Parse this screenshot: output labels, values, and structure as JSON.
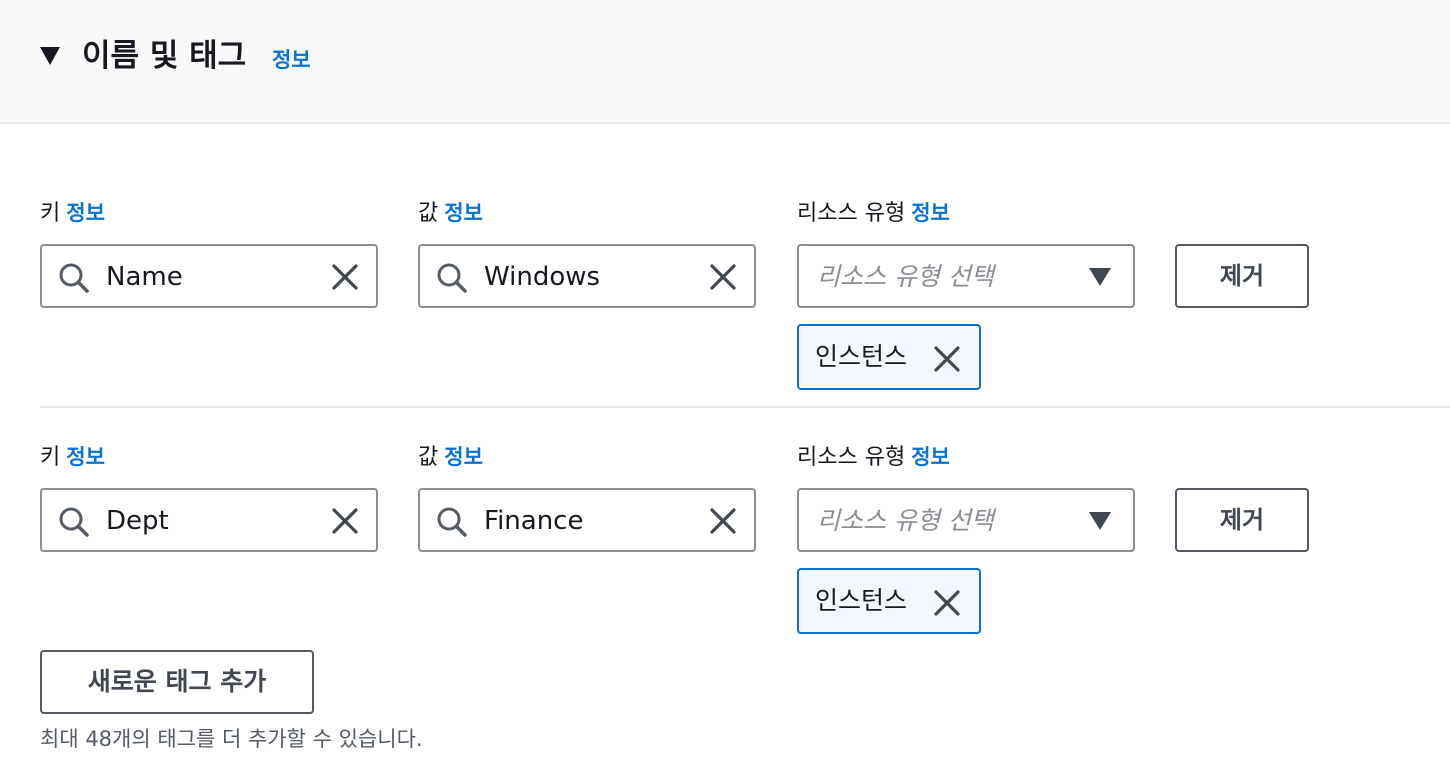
{
  "section": {
    "title": "이름 및 태그",
    "info": "정보"
  },
  "tags": [
    {
      "key_label": "키",
      "key_info": "정보",
      "key_value": "Name",
      "value_label": "값",
      "value_info": "정보",
      "value_value": "Windows",
      "resource_label": "리소스 유형",
      "resource_info": "정보",
      "resource_placeholder": "리소스 유형 선택",
      "resource_token": "인스턴스",
      "remove_label": "제거"
    },
    {
      "key_label": "키",
      "key_info": "정보",
      "key_value": "Dept",
      "value_label": "값",
      "value_info": "정보",
      "value_value": "Finance",
      "resource_label": "리소스 유형",
      "resource_info": "정보",
      "resource_placeholder": "리소스 유형 선택",
      "resource_token": "인스턴스",
      "remove_label": "제거"
    }
  ],
  "add_tag_label": "새로운 태그 추가",
  "hint": "최대 48개의 태그를 더 추가할 수 있습니다.",
  "colors": {
    "link": "#0972d3",
    "header_bg": "#f9f9f9",
    "border": "#8c8c94",
    "token_bg": "#f2f8fd"
  }
}
